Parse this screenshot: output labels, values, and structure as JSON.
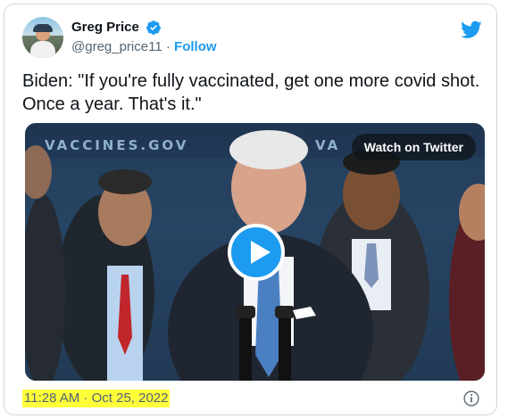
{
  "author": {
    "display_name": "Greg Price",
    "handle": "@greg_price11",
    "separator": " · ",
    "follow_label": "Follow",
    "verified": true
  },
  "tweet": {
    "text": "Biden: \"If you're fully vaccinated, get one more covid shot. Once a year. That's it.\"",
    "timestamp": "11:28 AM · Oct 25, 2022"
  },
  "media": {
    "banner_text": "VACCINES.GOV",
    "banner_text_partial": "VA",
    "watch_label": "Watch on Twitter"
  },
  "icons": {
    "brand": "twitter-bird-icon",
    "verified": "verified-badge-icon",
    "play": "play-icon",
    "info": "info-icon"
  },
  "colors": {
    "accent": "#1d9bf0",
    "text": "#0f1419",
    "muted": "#536471",
    "highlight": "#ffff3a"
  }
}
